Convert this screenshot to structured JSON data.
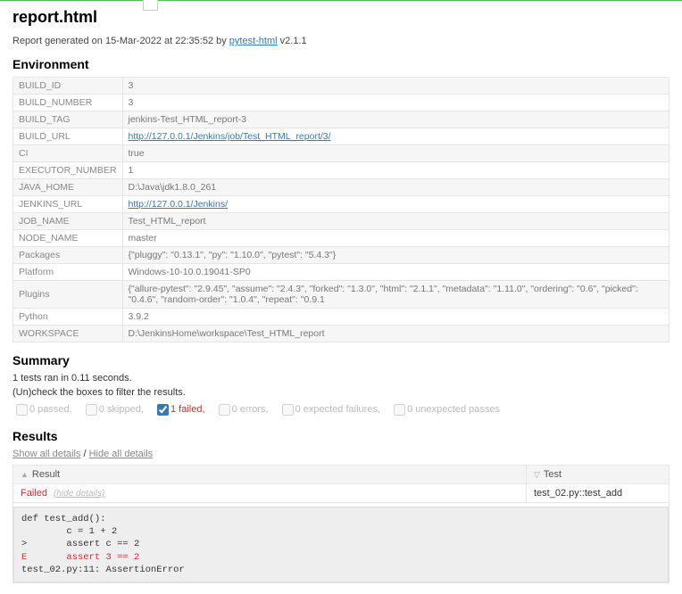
{
  "title": "report.html",
  "generated": {
    "prefix": "Report generated on ",
    "date": "15-Mar-2022 at 22:35:52",
    "by": " by ",
    "tool": "pytest-html",
    "version": " v2.1.1"
  },
  "sections": {
    "env": "Environment",
    "summary": "Summary",
    "results": "Results"
  },
  "env": [
    {
      "k": "BUILD_ID",
      "v": "3"
    },
    {
      "k": "BUILD_NUMBER",
      "v": "3"
    },
    {
      "k": "BUILD_TAG",
      "v": "jenkins-Test_HTML_report-3"
    },
    {
      "k": "BUILD_URL",
      "v": "http://127.0.0.1/Jenkins/job/Test_HTML_report/3/",
      "link": true
    },
    {
      "k": "CI",
      "v": "true"
    },
    {
      "k": "EXECUTOR_NUMBER",
      "v": "1"
    },
    {
      "k": "JAVA_HOME",
      "v": "D:\\Java\\jdk1.8.0_261"
    },
    {
      "k": "JENKINS_URL",
      "v": "http://127.0.0.1/Jenkins/",
      "link": true
    },
    {
      "k": "JOB_NAME",
      "v": "Test_HTML_report"
    },
    {
      "k": "NODE_NAME",
      "v": "master"
    },
    {
      "k": "Packages",
      "v": "{\"pluggy\": \"0.13.1\", \"py\": \"1.10.0\", \"pytest\": \"5.4.3\"}"
    },
    {
      "k": "Platform",
      "v": "Windows-10-10.0.19041-SP0"
    },
    {
      "k": "Plugins",
      "v": "{\"allure-pytest\": \"2.9.45\", \"assume\": \"2.4.3\", \"forked\": \"1.3.0\", \"html\": \"2.1.1\", \"metadata\": \"1.11.0\", \"ordering\": \"0.6\", \"picked\": \"0.4.6\", \"random-order\": \"1.0.4\", \"repeat\": \"0.9.1"
    },
    {
      "k": "Python",
      "v": "3.9.2"
    },
    {
      "k": "WORKSPACE",
      "v": "D:\\JenkinsHome\\workspace\\Test_HTML_report"
    }
  ],
  "summary": {
    "line": "1 tests ran in 0.11 seconds.",
    "hint": "(Un)check the boxes to filter the results."
  },
  "filters": {
    "passed": {
      "label": "0 passed,",
      "checked": false,
      "enabled": false,
      "cls": "passed"
    },
    "skipped": {
      "label": "0 skipped,",
      "checked": false,
      "enabled": false,
      "cls": "skipped"
    },
    "failed": {
      "label": "1 failed,",
      "checked": true,
      "enabled": true,
      "cls": "failed"
    },
    "errors": {
      "label": "0 errors,",
      "checked": false,
      "enabled": false,
      "cls": "errors"
    },
    "xfail": {
      "label": "0 expected failures,",
      "checked": false,
      "enabled": false,
      "cls": "xfail"
    },
    "xpass": {
      "label": "0 unexpected passes",
      "checked": false,
      "enabled": false,
      "cls": "xpass"
    }
  },
  "details_links": {
    "show": "Show all details",
    "sep": " / ",
    "hide": "Hide all details"
  },
  "results_table": {
    "headers": {
      "result": "Result",
      "test": "Test"
    },
    "row": {
      "result": "Failed",
      "hide": "(hide details)",
      "test": "test_02.py::test_add"
    }
  },
  "traceback": {
    "l1": "def test_add():",
    "l2": "        c = 1 + 2",
    "l3": ">       assert c == 2",
    "l4": "E       assert 3 == 2",
    "l5": "",
    "l6": "test_02.py:11: AssertionError"
  }
}
